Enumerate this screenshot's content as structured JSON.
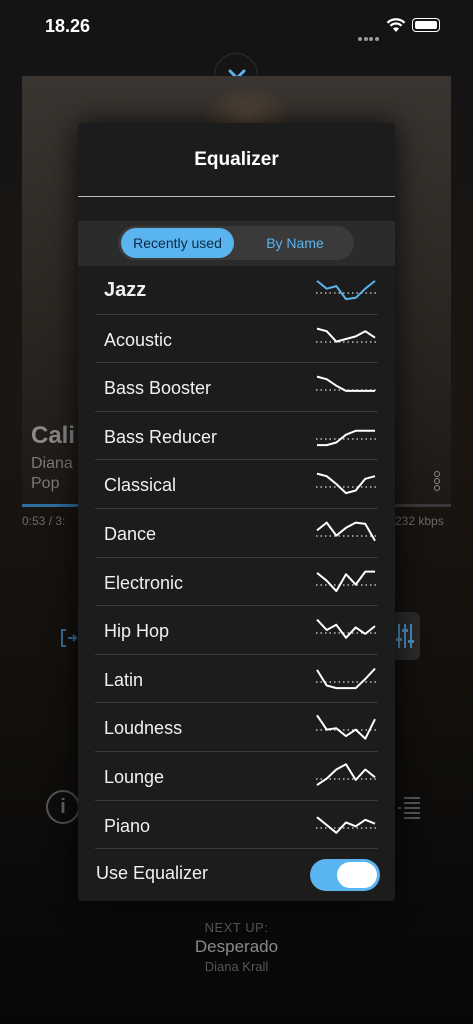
{
  "status_bar": {
    "time": "18.26"
  },
  "now_playing": {
    "title": "Cali",
    "artist": "Diana",
    "genre": "Pop",
    "elapsed": "0:53 / 3:",
    "bitrate": "232 kbps",
    "progress": 0.17
  },
  "next_up": {
    "label": "NEXT UP:",
    "title": "Desperado",
    "artist": "Diana Krall"
  },
  "equalizer": {
    "title": "Equalizer",
    "tabs": {
      "recent": "Recently used",
      "by_name": "By Name"
    },
    "presets": [
      {
        "label": "Jazz",
        "selected": true,
        "curve": [
          0.15,
          0.45,
          0.35,
          0.85,
          0.8,
          0.45,
          0.15
        ]
      },
      {
        "label": "Acoustic",
        "selected": false,
        "curve": [
          0.1,
          0.2,
          0.6,
          0.5,
          0.4,
          0.2,
          0.45
        ]
      },
      {
        "label": "Bass Booster",
        "selected": false,
        "curve": [
          0.1,
          0.2,
          0.45,
          0.65,
          0.65,
          0.65,
          0.65
        ]
      },
      {
        "label": "Bass Reducer",
        "selected": false,
        "curve": [
          0.85,
          0.85,
          0.75,
          0.45,
          0.3,
          0.3,
          0.3
        ]
      },
      {
        "label": "Classical",
        "selected": false,
        "curve": [
          0.1,
          0.2,
          0.5,
          0.85,
          0.75,
          0.3,
          0.2
        ]
      },
      {
        "label": "Dance",
        "selected": false,
        "curve": [
          0.4,
          0.1,
          0.6,
          0.3,
          0.1,
          0.15,
          0.8
        ]
      },
      {
        "label": "Electronic",
        "selected": false,
        "curve": [
          0.15,
          0.45,
          0.85,
          0.2,
          0.6,
          0.1,
          0.1
        ]
      },
      {
        "label": "Hip Hop",
        "selected": false,
        "curve": [
          0.1,
          0.5,
          0.3,
          0.8,
          0.4,
          0.65,
          0.35
        ]
      },
      {
        "label": "Latin",
        "selected": false,
        "curve": [
          0.15,
          0.75,
          0.85,
          0.85,
          0.85,
          0.5,
          0.1
        ]
      },
      {
        "label": "Loudness",
        "selected": false,
        "curve": [
          0.05,
          0.6,
          0.55,
          0.85,
          0.6,
          0.95,
          0.2
        ]
      },
      {
        "label": "Lounge",
        "selected": false,
        "curve": [
          0.85,
          0.6,
          0.25,
          0.05,
          0.65,
          0.25,
          0.55
        ]
      },
      {
        "label": "Piano",
        "selected": false,
        "curve": [
          0.2,
          0.5,
          0.8,
          0.4,
          0.55,
          0.3,
          0.45
        ]
      }
    ],
    "use_equalizer_label": "Use Equalizer",
    "use_equalizer_on": true
  },
  "colors": {
    "accent": "#5ab4ef",
    "panel": "#1c1c1c",
    "curve": "#ffffff"
  }
}
